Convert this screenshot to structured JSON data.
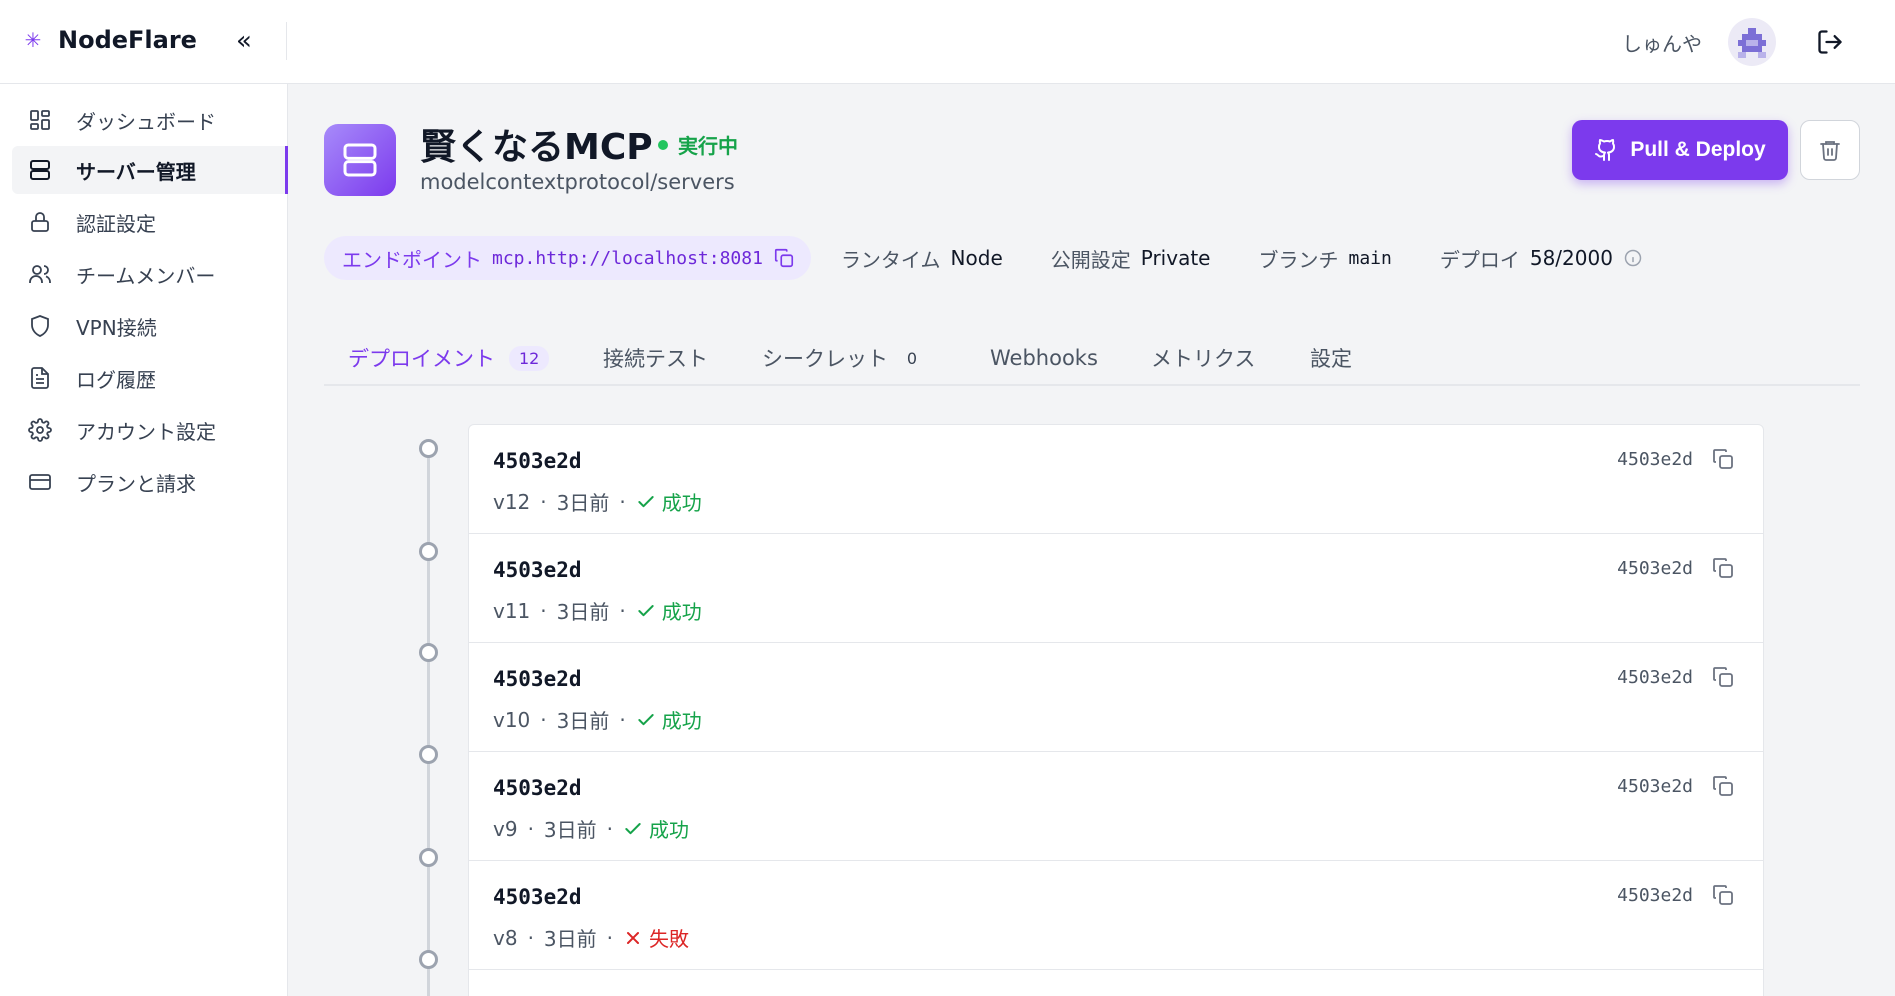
{
  "app": {
    "name": "NodeFlare",
    "brand_mark": "✳",
    "collapse_glyph": "«",
    "accent_color": "#7c3aed"
  },
  "header": {
    "user_name": "しゅんや",
    "avatar_icon": "pixel-avatar-icon",
    "logout_icon": "logout-icon"
  },
  "sidebar": {
    "items": [
      {
        "label": "ダッシュボード",
        "icon": "dashboard-icon"
      },
      {
        "label": "サーバー管理",
        "icon": "server-icon",
        "active": true
      },
      {
        "label": "認証設定",
        "icon": "lock-icon"
      },
      {
        "label": "チームメンバー",
        "icon": "users-icon"
      },
      {
        "label": "VPN接続",
        "icon": "shield-icon"
      },
      {
        "label": "ログ履歴",
        "icon": "file-text-icon"
      },
      {
        "label": "アカウント設定",
        "icon": "gear-icon"
      },
      {
        "label": "プランと請求",
        "icon": "credit-card-icon"
      }
    ]
  },
  "server": {
    "title": "賢くなるMCP",
    "status": "実行中",
    "status_color": "#16a34a",
    "repo": "modelcontextprotocol/servers"
  },
  "actions": {
    "deploy_label": "Pull & Deploy",
    "deploy_icon": "github-icon",
    "delete_icon": "trash-icon"
  },
  "meta": {
    "endpoint_label": "エンドポイント",
    "endpoint_value": "mcp.http://localhost:8081",
    "runtime_label": "ランタイム",
    "runtime_value": "Node",
    "visibility_label": "公開設定",
    "visibility_value": "Private",
    "branch_label": "ブランチ",
    "branch_value": "main",
    "deploys_label": "デプロイ",
    "deploys_value": "58/2000"
  },
  "tabs": [
    {
      "label": "デプロイメント",
      "count": "12",
      "active": true
    },
    {
      "label": "接続テスト",
      "count": ""
    },
    {
      "label": "シークレット",
      "count": "0"
    },
    {
      "label": "Webhooks",
      "count": ""
    },
    {
      "label": "メトリクス",
      "count": ""
    },
    {
      "label": "設定",
      "count": ""
    }
  ],
  "deployments": [
    {
      "hash": "4503e2d",
      "short": "4503e2d",
      "version": "v12",
      "age": "3日前",
      "status": "成功",
      "ok": true
    },
    {
      "hash": "4503e2d",
      "short": "4503e2d",
      "version": "v11",
      "age": "3日前",
      "status": "成功",
      "ok": true
    },
    {
      "hash": "4503e2d",
      "short": "4503e2d",
      "version": "v10",
      "age": "3日前",
      "status": "成功",
      "ok": true
    },
    {
      "hash": "4503e2d",
      "short": "4503e2d",
      "version": "v9",
      "age": "3日前",
      "status": "成功",
      "ok": true
    },
    {
      "hash": "4503e2d",
      "short": "4503e2d",
      "version": "v8",
      "age": "3日前",
      "status": "失敗",
      "ok": false
    }
  ],
  "separator": "·"
}
